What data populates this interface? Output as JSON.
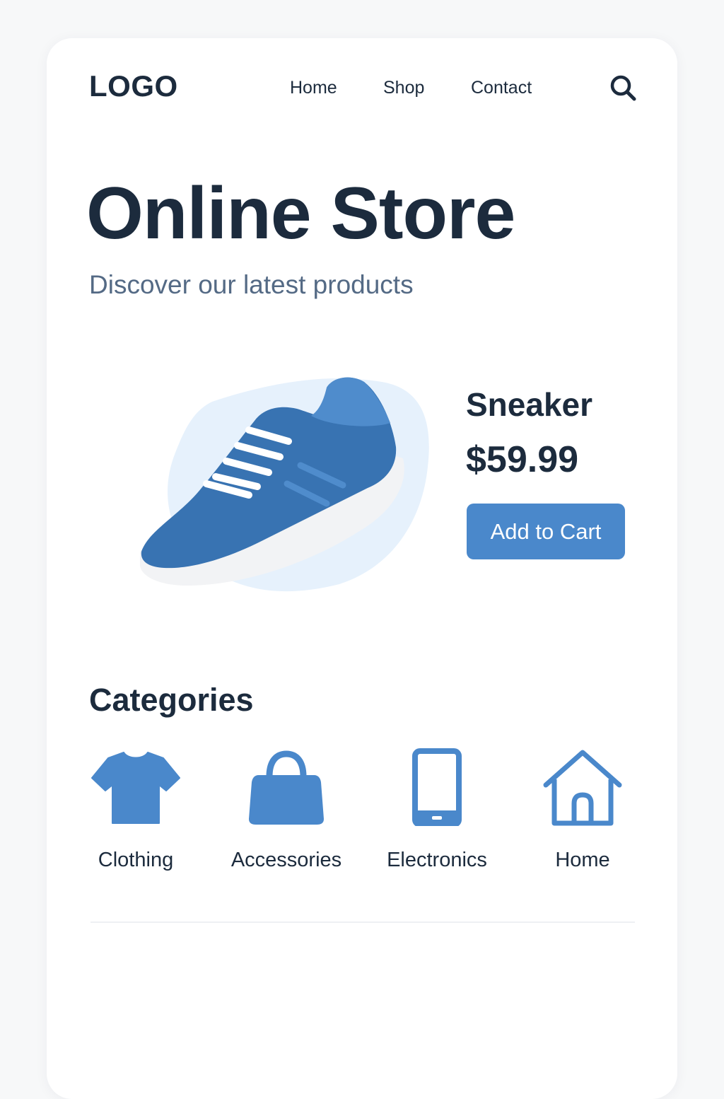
{
  "header": {
    "logo": "LOGO",
    "nav": [
      "Home",
      "Shop",
      "Contact"
    ],
    "search_icon": "search-icon"
  },
  "hero": {
    "title": "Online Store",
    "subtitle": "Discover our latest products"
  },
  "product": {
    "name": "Sneaker",
    "price": "$59.99",
    "button_label": "Add to Cart",
    "image_icon": "sneaker-image"
  },
  "categories": {
    "heading": "Categories",
    "items": [
      {
        "label": "Clothing",
        "icon": "tshirt-icon"
      },
      {
        "label": "Accessories",
        "icon": "handbag-icon"
      },
      {
        "label": "Electronics",
        "icon": "smartphone-icon"
      },
      {
        "label": "Home",
        "icon": "house-icon"
      }
    ]
  },
  "colors": {
    "accent": "#4a88cb",
    "text_dark": "#1c2b3d",
    "text_muted": "#546a85",
    "blob": "#e6f1fc"
  }
}
